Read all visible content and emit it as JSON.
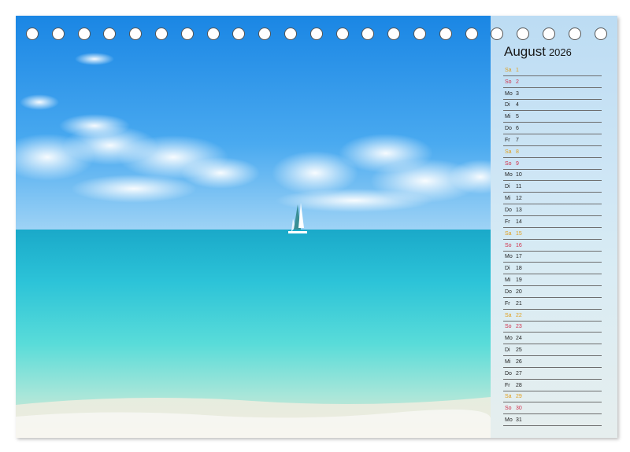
{
  "calendar": {
    "month": "August",
    "year": "2026",
    "days": [
      {
        "wd": "Sa",
        "d": "1",
        "type": "sat"
      },
      {
        "wd": "So",
        "d": "2",
        "type": "sun"
      },
      {
        "wd": "Mo",
        "d": "3",
        "type": "wk"
      },
      {
        "wd": "Di",
        "d": "4",
        "type": "wk"
      },
      {
        "wd": "Mi",
        "d": "5",
        "type": "wk"
      },
      {
        "wd": "Do",
        "d": "6",
        "type": "wk"
      },
      {
        "wd": "Fr",
        "d": "7",
        "type": "wk"
      },
      {
        "wd": "Sa",
        "d": "8",
        "type": "sat"
      },
      {
        "wd": "So",
        "d": "9",
        "type": "sun"
      },
      {
        "wd": "Mo",
        "d": "10",
        "type": "wk"
      },
      {
        "wd": "Di",
        "d": "11",
        "type": "wk"
      },
      {
        "wd": "Mi",
        "d": "12",
        "type": "wk"
      },
      {
        "wd": "Do",
        "d": "13",
        "type": "wk"
      },
      {
        "wd": "Fr",
        "d": "14",
        "type": "wk"
      },
      {
        "wd": "Sa",
        "d": "15",
        "type": "sat"
      },
      {
        "wd": "So",
        "d": "16",
        "type": "sun"
      },
      {
        "wd": "Mo",
        "d": "17",
        "type": "wk"
      },
      {
        "wd": "Di",
        "d": "18",
        "type": "wk"
      },
      {
        "wd": "Mi",
        "d": "19",
        "type": "wk"
      },
      {
        "wd": "Do",
        "d": "20",
        "type": "wk"
      },
      {
        "wd": "Fr",
        "d": "21",
        "type": "wk"
      },
      {
        "wd": "Sa",
        "d": "22",
        "type": "sat"
      },
      {
        "wd": "So",
        "d": "23",
        "type": "sun"
      },
      {
        "wd": "Mo",
        "d": "24",
        "type": "wk"
      },
      {
        "wd": "Di",
        "d": "25",
        "type": "wk"
      },
      {
        "wd": "Mi",
        "d": "26",
        "type": "wk"
      },
      {
        "wd": "Do",
        "d": "27",
        "type": "wk"
      },
      {
        "wd": "Fr",
        "d": "28",
        "type": "wk"
      },
      {
        "wd": "Sa",
        "d": "29",
        "type": "sat"
      },
      {
        "wd": "So",
        "d": "30",
        "type": "sun"
      },
      {
        "wd": "Mo",
        "d": "31",
        "type": "wk"
      }
    ]
  },
  "colors": {
    "saturday": "#e0a020",
    "sunday": "#d0304a",
    "weekday": "#222222",
    "sky_top": "#1e8fe6",
    "sea": "#2fc4d8"
  },
  "binding": {
    "hole_count": 23
  },
  "photo": {
    "subject": "tropical beach with catamaran sailboat"
  }
}
